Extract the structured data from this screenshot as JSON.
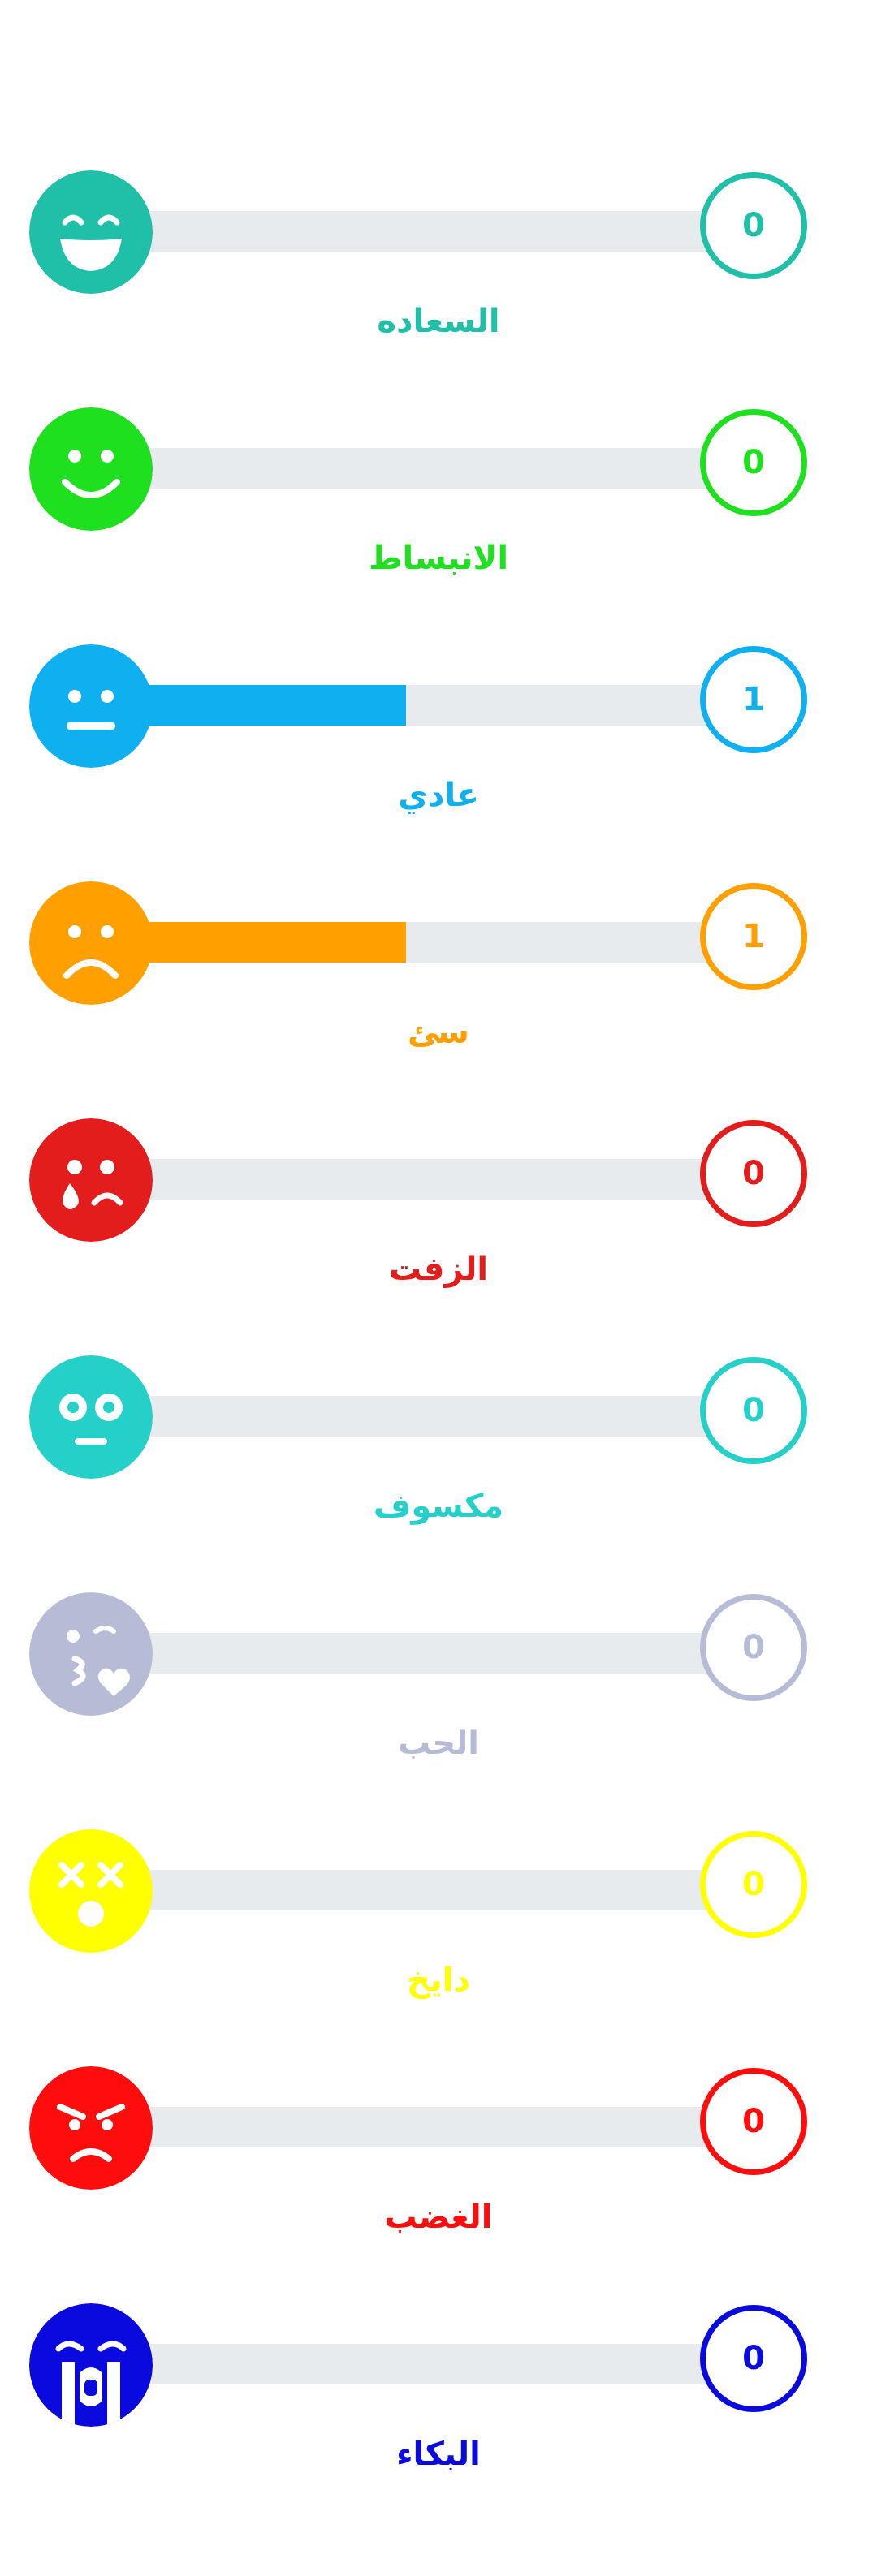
{
  "reactions": [
    {
      "key": "happiness",
      "label": "السعاده",
      "count": "0",
      "level": 0,
      "color": "#1fbfa8",
      "icon": "grinning-face-icon"
    },
    {
      "key": "joy",
      "label": "الانبساط",
      "count": "0",
      "level": 0,
      "color": "#1ee01e",
      "icon": "smiling-face-icon"
    },
    {
      "key": "neutral",
      "label": "عادي",
      "count": "1",
      "level": 0.5,
      "color": "#0fb0f0",
      "icon": "neutral-face-icon"
    },
    {
      "key": "bad",
      "label": "سئ",
      "count": "1",
      "level": 0.5,
      "color": "#ffa000",
      "icon": "frowning-face-icon"
    },
    {
      "key": "fed-up",
      "label": "الزفت",
      "count": "0",
      "level": 0,
      "color": "#e31c1c",
      "icon": "crying-tear-face-icon"
    },
    {
      "key": "embarrassed",
      "label": "مكسوف",
      "count": "0",
      "level": 0,
      "color": "#24d0c8",
      "icon": "flushed-face-icon"
    },
    {
      "key": "love",
      "label": "الحب",
      "count": "0",
      "level": 0,
      "color": "#b7bcd6",
      "icon": "kissing-heart-face-icon"
    },
    {
      "key": "dizzy",
      "label": "دايخ",
      "count": "0",
      "level": 0,
      "color": "#ffff00",
      "icon": "dizzy-face-icon"
    },
    {
      "key": "anger",
      "label": "الغضب",
      "count": "0",
      "level": 0,
      "color": "#ff0d0d",
      "icon": "angry-face-icon"
    },
    {
      "key": "crying",
      "label": "البكاء",
      "count": "0",
      "level": 0,
      "color": "#0a0adf",
      "icon": "loudly-crying-face-icon"
    }
  ]
}
